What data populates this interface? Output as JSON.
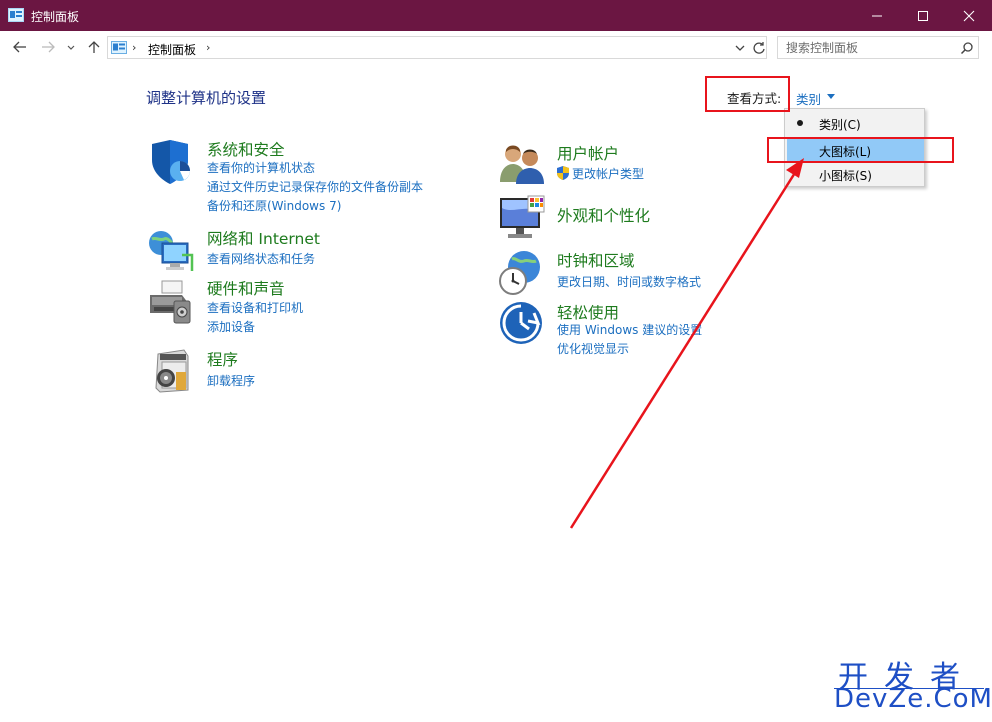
{
  "window": {
    "title": "控制面板",
    "minimize_icon": "minimize-icon",
    "maximize_icon": "maximize-icon",
    "close_icon": "close-icon",
    "titlebar_color": "#6b1642"
  },
  "nav": {
    "breadcrumb": [
      "控制面板"
    ],
    "search_placeholder": "搜索控制面板"
  },
  "content": {
    "heading": "调整计算机的设置",
    "view_by_label": "查看方式:",
    "view_by_value": "类别"
  },
  "view_menu": {
    "items": [
      {
        "label": "类别(C)",
        "checked": true
      },
      {
        "label": "大图标(L)",
        "checked": false,
        "highlighted": true
      },
      {
        "label": "小图标(S)",
        "checked": false
      }
    ]
  },
  "categories_left": [
    {
      "title": "系统和安全",
      "icon": "shield-icon",
      "links": [
        "查看你的计算机状态",
        "通过文件历史记录保存你的文件备份副本",
        "备份和还原(Windows 7)"
      ]
    },
    {
      "title": "网络和 Internet",
      "icon": "network-icon",
      "links": [
        "查看网络状态和任务"
      ]
    },
    {
      "title": "硬件和声音",
      "icon": "printer-icon",
      "links": [
        "查看设备和打印机",
        "添加设备"
      ]
    },
    {
      "title": "程序",
      "icon": "programs-icon",
      "links": [
        "卸载程序"
      ]
    }
  ],
  "categories_right": [
    {
      "title": "用户帐户",
      "icon": "users-icon",
      "links": [
        "更改帐户类型"
      ]
    },
    {
      "title": "外观和个性化",
      "icon": "monitor-icon",
      "links": []
    },
    {
      "title": "时钟和区域",
      "icon": "clock-icon",
      "links": [
        "更改日期、时间或数字格式"
      ]
    },
    {
      "title": "轻松使用",
      "icon": "ease-of-access-icon",
      "links": [
        "使用 Windows 建议的设置",
        "优化视觉显示"
      ]
    }
  ],
  "watermark": {
    "line1": "开发者",
    "line2": "DevZe.CoM"
  },
  "colors": {
    "category_title": "#1e7b1e",
    "link": "#1c6fc0",
    "heading": "#1e3287",
    "annotation_red": "#e8141c",
    "menu_highlight": "#91c9f7"
  }
}
